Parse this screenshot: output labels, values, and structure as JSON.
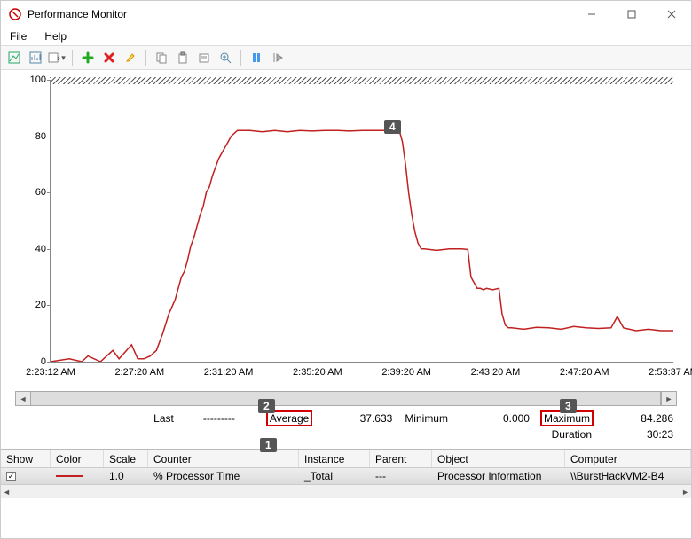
{
  "window": {
    "title": "Performance Monitor"
  },
  "menus": {
    "file": "File",
    "help": "Help"
  },
  "callouts": {
    "c1": "1",
    "c2": "2",
    "c3": "3",
    "c4": "4"
  },
  "stats": {
    "last_label": "Last",
    "last_val": "---------",
    "avg_label": "Average",
    "avg_val": "37.633",
    "min_label": "Minimum",
    "min_val": "0.000",
    "max_label": "Maximum",
    "max_val": "84.286",
    "dur_label": "Duration",
    "dur_val": "30:23"
  },
  "table": {
    "headers": {
      "show": "Show",
      "color": "Color",
      "scale": "Scale",
      "counter": "Counter",
      "instance": "Instance",
      "parent": "Parent",
      "object": "Object",
      "computer": "Computer"
    },
    "row": {
      "show": "✓",
      "scale": "1.0",
      "counter": "% Processor Time",
      "instance": "_Total",
      "parent": "---",
      "object": "Processor Information",
      "computer": "\\\\BurstHackVM2-B4"
    }
  },
  "chart_data": {
    "type": "line",
    "title": "",
    "xlabel": "",
    "ylabel": "",
    "ylim": [
      0,
      100
    ],
    "yticks": [
      0,
      20,
      40,
      60,
      80,
      100
    ],
    "xticks": [
      "2:23:12 AM",
      "2:27:20 AM",
      "2:31:20 AM",
      "2:35:20 AM",
      "2:39:20 AM",
      "2:43:20 AM",
      "2:47:20 AM",
      "2:53:37 AM"
    ],
    "series": [
      {
        "name": "% Processor Time",
        "color": "#c02020",
        "points": [
          [
            0.0,
            0
          ],
          [
            0.03,
            1
          ],
          [
            0.05,
            0
          ],
          [
            0.06,
            2
          ],
          [
            0.08,
            0
          ],
          [
            0.1,
            4
          ],
          [
            0.11,
            1
          ],
          [
            0.13,
            6
          ],
          [
            0.14,
            1
          ],
          [
            0.15,
            1
          ],
          [
            0.16,
            2
          ],
          [
            0.17,
            4
          ],
          [
            0.18,
            10
          ],
          [
            0.19,
            17
          ],
          [
            0.2,
            22
          ],
          [
            0.21,
            30
          ],
          [
            0.215,
            32
          ],
          [
            0.22,
            36
          ],
          [
            0.225,
            41
          ],
          [
            0.23,
            44
          ],
          [
            0.24,
            52
          ],
          [
            0.245,
            55
          ],
          [
            0.25,
            60
          ],
          [
            0.255,
            62
          ],
          [
            0.26,
            66
          ],
          [
            0.27,
            72
          ],
          [
            0.28,
            76
          ],
          [
            0.29,
            80
          ],
          [
            0.3,
            82
          ],
          [
            0.32,
            82
          ],
          [
            0.34,
            81.5
          ],
          [
            0.36,
            82
          ],
          [
            0.38,
            81.5
          ],
          [
            0.4,
            82
          ],
          [
            0.42,
            81.8
          ],
          [
            0.44,
            82
          ],
          [
            0.46,
            82
          ],
          [
            0.48,
            81.8
          ],
          [
            0.5,
            82
          ],
          [
            0.52,
            82
          ],
          [
            0.54,
            82
          ],
          [
            0.56,
            82
          ],
          [
            0.565,
            78
          ],
          [
            0.57,
            70
          ],
          [
            0.575,
            60
          ],
          [
            0.58,
            52
          ],
          [
            0.585,
            46
          ],
          [
            0.59,
            42
          ],
          [
            0.595,
            40
          ],
          [
            0.6,
            40
          ],
          [
            0.62,
            39.5
          ],
          [
            0.64,
            40
          ],
          [
            0.66,
            40
          ],
          [
            0.67,
            39.8
          ],
          [
            0.675,
            30
          ],
          [
            0.68,
            28
          ],
          [
            0.685,
            26
          ],
          [
            0.69,
            26
          ],
          [
            0.695,
            25.5
          ],
          [
            0.7,
            26
          ],
          [
            0.71,
            25.5
          ],
          [
            0.72,
            26
          ],
          [
            0.725,
            17
          ],
          [
            0.73,
            13
          ],
          [
            0.735,
            12
          ],
          [
            0.74,
            12
          ],
          [
            0.76,
            11.5
          ],
          [
            0.78,
            12.2
          ],
          [
            0.8,
            12
          ],
          [
            0.82,
            11.5
          ],
          [
            0.84,
            12.5
          ],
          [
            0.86,
            12
          ],
          [
            0.88,
            11.8
          ],
          [
            0.9,
            12
          ],
          [
            0.91,
            16
          ],
          [
            0.92,
            12
          ],
          [
            0.94,
            11
          ],
          [
            0.96,
            11.5
          ],
          [
            0.98,
            11
          ],
          [
            1.0,
            11
          ]
        ]
      }
    ]
  }
}
